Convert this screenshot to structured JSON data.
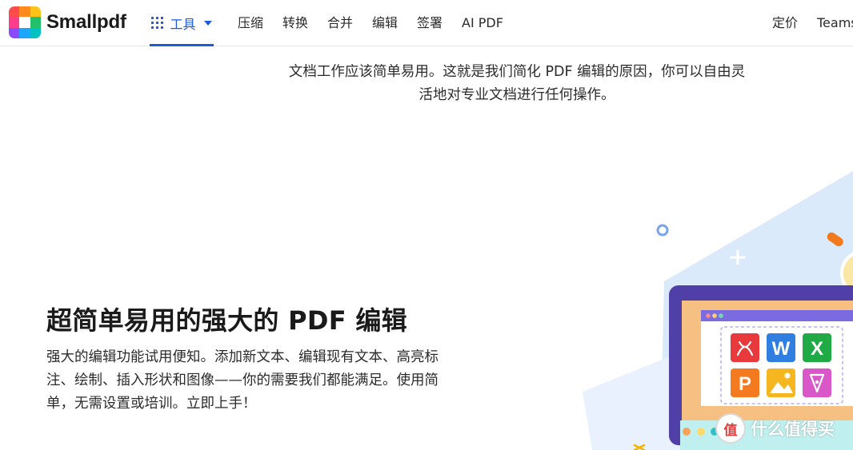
{
  "header": {
    "brand": "Smallpdf",
    "tools_label": "工具",
    "nav": [
      {
        "label": "压缩"
      },
      {
        "label": "转换"
      },
      {
        "label": "合并"
      },
      {
        "label": "编辑"
      },
      {
        "label": "签署"
      },
      {
        "label": "AI PDF"
      }
    ],
    "right_nav": [
      {
        "label": "定价"
      },
      {
        "label": "Teams"
      }
    ]
  },
  "hero": {
    "intro_line1": "文档工作应该简单易用。这就是我们简化 PDF 编辑的原因，你可以自由灵",
    "intro_line2": "活地对专业文档进行任何操作。"
  },
  "feature": {
    "title": "超简单易用的强大的 PDF 编辑",
    "desc_line1": "强大的编辑功能试用便知。添加新文本、编辑现有文本、高亮标",
    "desc_line2": "注、绘制、插入形状和图像——你的需要我们都能满足。使用简",
    "desc_line3": "单，无需设置或培训。立即上手！"
  },
  "illustration": {
    "app_tiles": [
      {
        "icon": "acrobat-icon",
        "color": "#e8393d"
      },
      {
        "icon": "word-icon",
        "letter": "W",
        "color": "#2f7ee0"
      },
      {
        "icon": "excel-icon",
        "letter": "X",
        "color": "#1faa46"
      },
      {
        "icon": "powerpoint-icon",
        "letter": "P",
        "color": "#f37a1f"
      },
      {
        "icon": "image-icon",
        "color": "#f6b620"
      },
      {
        "icon": "pen-icon",
        "color": "#d957c9"
      }
    ]
  },
  "watermark": {
    "badge": "值",
    "text": "什么值得买"
  },
  "colors": {
    "accent": "#1f5bd8",
    "text": "#2b2b2b",
    "laptop_frame": "#5b4ac0",
    "laptop_screen_border": "#f7c083"
  }
}
